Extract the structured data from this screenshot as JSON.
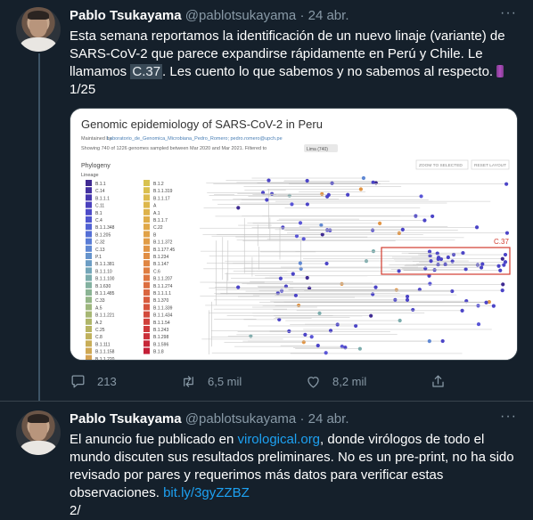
{
  "tweets": [
    {
      "name": "Pablo Tsukayama",
      "handle": "@pablotsukayama",
      "separator": "·",
      "date": "24 abr.",
      "more": "···",
      "text": {
        "line1": "Esta semana reportamos la identificación de un nuevo linaje (variante) de",
        "line2": "SARS-CoV-2 que parece expandirse rápidamente en Perú y Chile. Le",
        "line3_a": "llamamos ",
        "line3_highlight": "C.37",
        "line3_b": ".  Les cuento lo que sabemos y no sabemos al respecto. ",
        "line4": "1/25"
      },
      "counts": {
        "replies": "213",
        "retweets": "6,5 mil",
        "likes": "8,2 mil"
      }
    },
    {
      "name": "Pablo Tsukayama",
      "handle": "@pablotsukayama",
      "separator": "·",
      "date": "24 abr.",
      "more": "···",
      "text": {
        "line1_a": "El anuncio fue publicado en ",
        "line1_link": "virological.org",
        "line1_b": ", donde virólogos de todo el",
        "line2": "mundo discuten sus resultados preliminares. No es un pre-print, no ha sido",
        "line3": "revisado por pares y requerimos más datos para verificar estas",
        "line4_a": "observaciones. ",
        "line4_link": "bit.ly/3gyZZBZ",
        "line5": "2/"
      }
    }
  ],
  "embedded_image": {
    "title": "Genomic epidemiology of SARS-CoV-2 in Peru",
    "maintained_prefix": "Maintained by ",
    "maintained_by": "Laboratorio_de_Genomica_Microbiana_Pedro_Romero; pedro.romero@upch.pe",
    "showing": "Showing 740 of 1226 genomes sampled between Mar 2020 and Mar 2021. Filtered to",
    "filter_chip": "Lima (740)",
    "buttons": {
      "zoom": "ZOOM TO SELECTED",
      "reset": "RESET LAYOUT"
    },
    "phylogeny_label": "Phylogeny",
    "lineage_label": "Lineage",
    "callout": "C.37",
    "legend_col1": [
      {
        "label": "B.1.1",
        "color": "#3f2a91"
      },
      {
        "label": "C.14",
        "color": "#4330a0"
      },
      {
        "label": "B.1.1.1",
        "color": "#4637b0"
      },
      {
        "label": "C.11",
        "color": "#4a40bd"
      },
      {
        "label": "B.1",
        "color": "#4d4bc8"
      },
      {
        "label": "C.4",
        "color": "#4f56cf"
      },
      {
        "label": "B.1.1.348",
        "color": "#5162d4"
      },
      {
        "label": "B.1.205",
        "color": "#546fd6"
      },
      {
        "label": "C.32",
        "color": "#597cd6"
      },
      {
        "label": "C.13",
        "color": "#5f88d3"
      },
      {
        "label": "P.1",
        "color": "#6593cc"
      },
      {
        "label": "B.1.1.381",
        "color": "#6c9dc4"
      },
      {
        "label": "B.1.1.10",
        "color": "#73a6b9"
      },
      {
        "label": "B.1.1.100",
        "color": "#7bacac"
      },
      {
        "label": "B.1.630",
        "color": "#83b1a0"
      },
      {
        "label": "B.1.1.485",
        "color": "#8bb494"
      },
      {
        "label": "C.33",
        "color": "#94b688"
      },
      {
        "label": "A.5",
        "color": "#9db77d"
      },
      {
        "label": "B.1.1.221",
        "color": "#a6b773"
      },
      {
        "label": "A.2",
        "color": "#afb66a"
      },
      {
        "label": "C.25",
        "color": "#b8b462"
      },
      {
        "label": "C.8",
        "color": "#c0b15c"
      },
      {
        "label": "B.1.111",
        "color": "#c8ad57"
      },
      {
        "label": "B.1.1.158",
        "color": "#cfa854"
      },
      {
        "label": "B.1.1.220",
        "color": "#d5a253"
      }
    ],
    "legend_col2": [
      {
        "label": "B.1.2",
        "color": "#d8c250"
      },
      {
        "label": "B.1.1.319",
        "color": "#dabf4e"
      },
      {
        "label": "B.1.1.17",
        "color": "#dcbb4c"
      },
      {
        "label": "A",
        "color": "#ddb74b"
      },
      {
        "label": "A.1",
        "color": "#deb24a"
      },
      {
        "label": "B.1.1.7",
        "color": "#dfad49"
      },
      {
        "label": "C.22",
        "color": "#e0a848"
      },
      {
        "label": "B",
        "color": "#e1a247"
      },
      {
        "label": "B.1.1.372",
        "color": "#e19c46"
      },
      {
        "label": "B.1.177.45",
        "color": "#e19545"
      },
      {
        "label": "B.1.234",
        "color": "#e18e44"
      },
      {
        "label": "B.1.147",
        "color": "#e08643"
      },
      {
        "label": "C.6",
        "color": "#df7e42"
      },
      {
        "label": "B.1.1.207",
        "color": "#de7641"
      },
      {
        "label": "B.1.1.274",
        "color": "#dc6e40"
      },
      {
        "label": "B.1.1.1.1",
        "color": "#da653f"
      },
      {
        "label": "B.1.370",
        "color": "#d85c3e"
      },
      {
        "label": "B.1.1.339",
        "color": "#d6533d"
      },
      {
        "label": "B.1.1.434",
        "color": "#d34a3c"
      },
      {
        "label": "B.1.1.54",
        "color": "#d0413b"
      },
      {
        "label": "B.1.243",
        "color": "#cd383a"
      },
      {
        "label": "B.1.298",
        "color": "#ca2f39"
      },
      {
        "label": "B.1.596",
        "color": "#c72738"
      },
      {
        "label": "B.1.8",
        "color": "#c41f37"
      }
    ]
  },
  "colors": {
    "background": "#15202b",
    "secondary": "#8899a6",
    "link": "#1da1f2",
    "separator": "#38444d"
  },
  "icons": [
    "reply-icon",
    "retweet-icon",
    "like-icon",
    "share-icon",
    "more-icon",
    "thread-icon"
  ]
}
